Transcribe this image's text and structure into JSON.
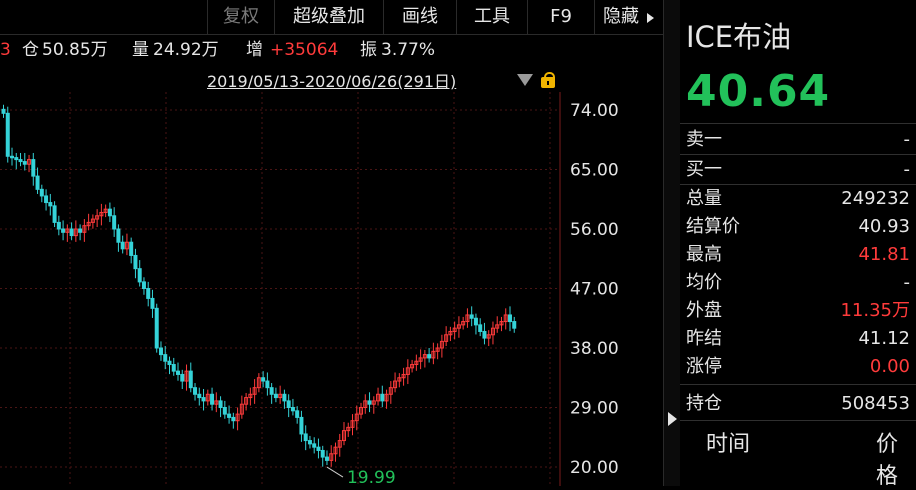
{
  "toolbar": {
    "fuquan": "复权",
    "chaojidiejia": "超级叠加",
    "huaxian": "画线",
    "gongju": "工具",
    "f9": "F9",
    "yincang": "隐藏"
  },
  "infobar": {
    "cang_label": "仓",
    "cang_value": "50.85万",
    "liang_label": "量",
    "liang_value": "24.92万",
    "zeng_label": "增",
    "zeng_value": "+35064",
    "zhen_label": "振",
    "zhen_value": "3.77%"
  },
  "date_range": "2019/05/13-2020/06/26(291日)",
  "colors": {
    "up": "#ff3b3b",
    "down": "#22c15a",
    "candle_down": "#35d3d8",
    "accent_lock": "#f0b400"
  },
  "chart_data": {
    "type": "candlestick",
    "y_axis_ticks": [
      "74.00",
      "65.00",
      "56.00",
      "47.00",
      "38.00",
      "29.00",
      "20.00"
    ],
    "ylim": [
      20,
      74
    ],
    "min_label": "19.99",
    "min_value": 19.99,
    "close_series": [
      73.5,
      67,
      66.8,
      66.5,
      66.2,
      65.8,
      66.5,
      64,
      62,
      61,
      60,
      59.5,
      57,
      56,
      55.5,
      56,
      55,
      56,
      55.5,
      56.5,
      57,
      57.5,
      58,
      58.5,
      59,
      58,
      56,
      54,
      53,
      54,
      52,
      50,
      48,
      47,
      45.5,
      44,
      38,
      37,
      36,
      35.5,
      34.5,
      34,
      33,
      34.5,
      32,
      31,
      30.5,
      30,
      31,
      29.5,
      30,
      29,
      28,
      27.5,
      27,
      28,
      29.5,
      30.5,
      31,
      32,
      33.5,
      33,
      32,
      31,
      30.5,
      31,
      30,
      29,
      28.5,
      27.5,
      25,
      24,
      23.5,
      23,
      22.5,
      21.5,
      21,
      22,
      23,
      24,
      25.5,
      26,
      27,
      28,
      29,
      30,
      29.5,
      30,
      31,
      30,
      31,
      32,
      33,
      33.5,
      34,
      35,
      35.5,
      36,
      36.5,
      37,
      36.5,
      37.5,
      38,
      39,
      40,
      40.5,
      41,
      41.5,
      42,
      43,
      42.5,
      41.5,
      40.5,
      39.5,
      40,
      41,
      41.5,
      42,
      43,
      42,
      41
    ]
  },
  "right_panel": {
    "title": "ICE布油",
    "price": "40.64",
    "rows": [
      {
        "label": "卖一",
        "value": "-"
      },
      {
        "label": "买一",
        "value": "-"
      },
      {
        "label": "总量",
        "value": "249232"
      },
      {
        "label": "结算价",
        "value": "40.93"
      },
      {
        "label": "最高",
        "value": "41.81"
      },
      {
        "label": "均价",
        "value": "-"
      },
      {
        "label": "外盘",
        "value": "11.35万"
      },
      {
        "label": "昨结",
        "value": "41.12"
      },
      {
        "label": "涨停",
        "value": "0.00"
      },
      {
        "label": "持仓",
        "value": "508453"
      }
    ],
    "table_header_time": "时间",
    "table_header_price": "价格"
  }
}
